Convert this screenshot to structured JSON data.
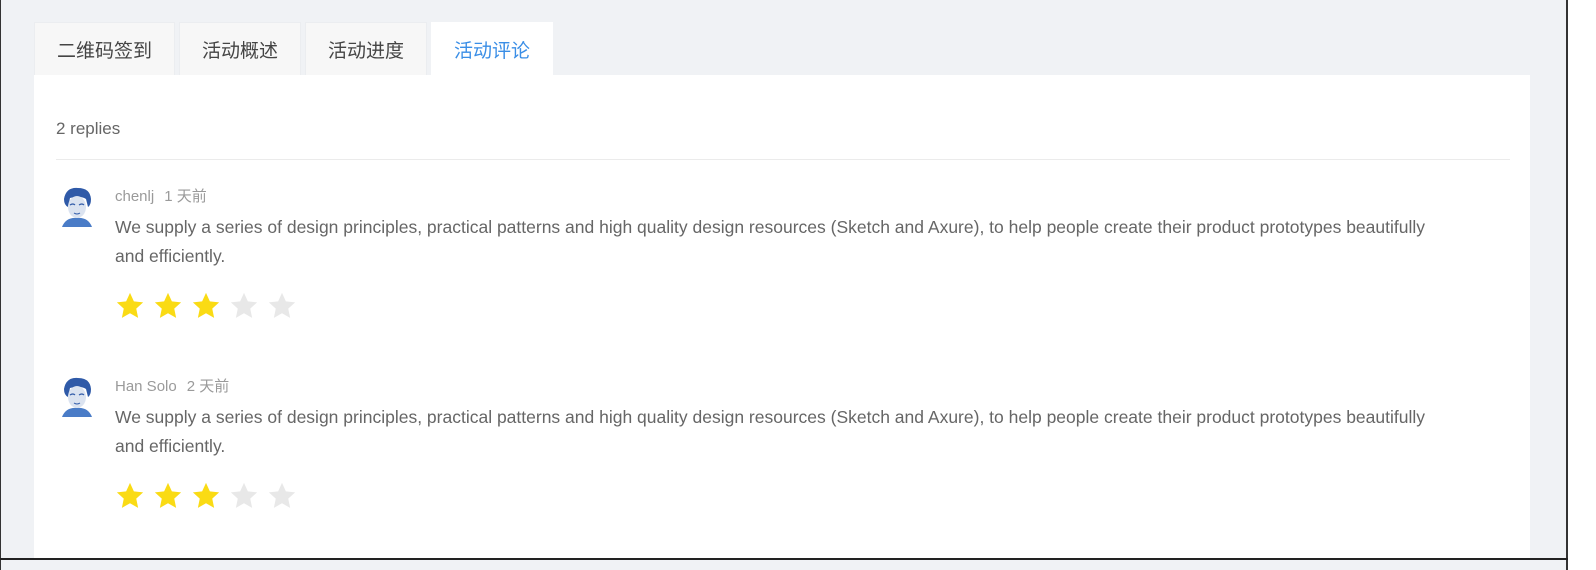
{
  "tabs": [
    {
      "label": "二维码签到",
      "active": false
    },
    {
      "label": "活动概述",
      "active": false
    },
    {
      "label": "活动进度",
      "active": false
    },
    {
      "label": "活动评论",
      "active": true
    }
  ],
  "replies_label": "2 replies",
  "comments": [
    {
      "author": "chenlj",
      "time": "1 天前",
      "text": "We supply a series of design principles, practical patterns and high quality design resources (Sketch and Axure), to help people create their product prototypes beautifully and efficiently.",
      "rating": 3,
      "max_rating": 5
    },
    {
      "author": "Han Solo",
      "time": "2 天前",
      "text": "We supply a series of design principles, practical patterns and high quality design resources (Sketch and Axure), to help people create their product prototypes beautifully and efficiently.",
      "rating": 3,
      "max_rating": 5
    }
  ],
  "colors": {
    "accent": "#3a8ee6",
    "star_on": "#fadb14",
    "star_off": "#e8e8e8"
  },
  "icons": {
    "avatar": "avatar-icon",
    "star": "star-icon"
  }
}
